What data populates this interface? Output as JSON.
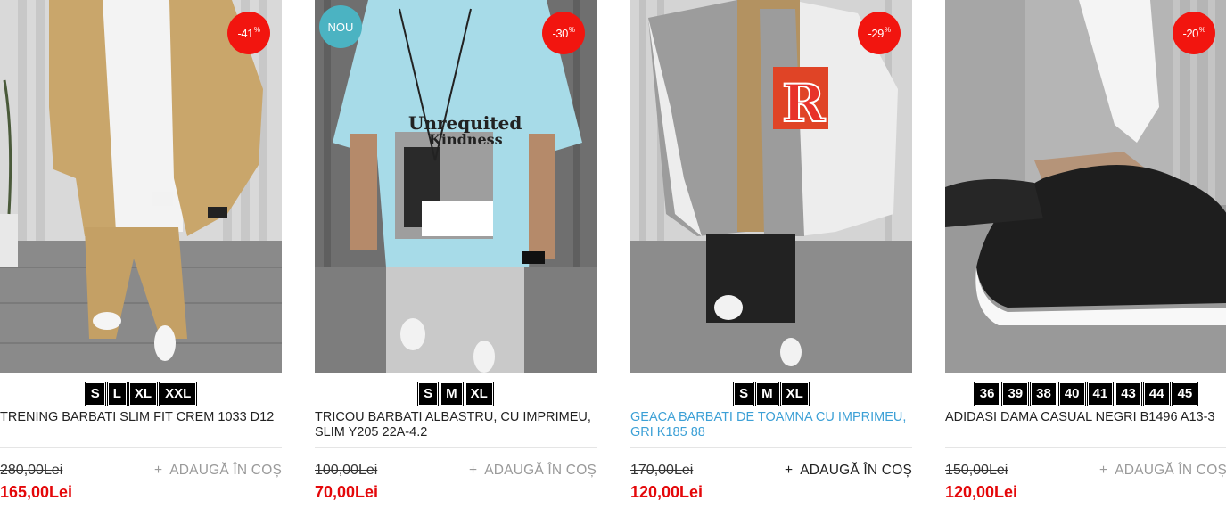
{
  "products": [
    {
      "discount": "-41",
      "percent_sign": "%",
      "new_badge": "",
      "sizes": [
        "S",
        "L",
        "XL",
        "XXL"
      ],
      "title": "TRENING BARBATI SLIM FIT CREM 1033 D12",
      "old_price": "280,00Lei",
      "new_price": "165,00Lei",
      "cart_label": "ADAUGĂ ÎN COȘ",
      "cart_plus": "+"
    },
    {
      "discount": "-30",
      "percent_sign": "%",
      "new_badge": "NOU",
      "sizes": [
        "S",
        "M",
        "XL"
      ],
      "title": "TRICOU BARBATI ALBASTRU, CU IMPRIMEU, SLIM Y205 22A-4.2",
      "old_price": "100,00Lei",
      "new_price": "70,00Lei",
      "cart_label": "ADAUGĂ ÎN COȘ",
      "cart_plus": "+",
      "print_text_1": "Unrequited",
      "print_text_2": "Kindness"
    },
    {
      "discount": "-29",
      "percent_sign": "%",
      "new_badge": "",
      "sizes": [
        "S",
        "M",
        "XL"
      ],
      "title": "GEACA BARBATI DE TOAMNA CU IMPRIMEU, GRI K185 88",
      "old_price": "170,00Lei",
      "new_price": "120,00Lei",
      "cart_label": "ADAUGĂ ÎN COȘ",
      "cart_plus": "+",
      "jacket_letter": "R"
    },
    {
      "discount": "-20",
      "percent_sign": "%",
      "new_badge": "",
      "sizes": [
        "36",
        "39",
        "38",
        "40",
        "41",
        "43",
        "44",
        "45"
      ],
      "title": "ADIDASI DAMA CASUAL NEGRI B1496 A13-3",
      "old_price": "150,00Lei",
      "new_price": "120,00Lei",
      "cart_label": "ADAUGĂ ÎN COȘ",
      "cart_plus": "+"
    }
  ],
  "colors": {
    "discount_badge": "#f2150f",
    "new_badge": "#4bb3c2",
    "sale_price": "#e4080a",
    "hover_title": "#3ca0d6"
  }
}
